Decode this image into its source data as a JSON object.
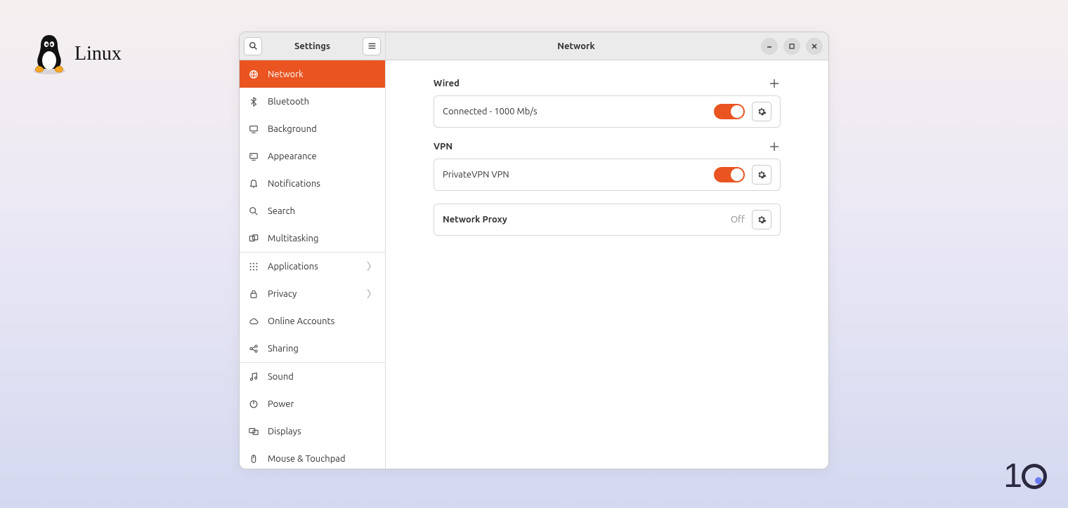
{
  "os_label": "Linux",
  "sidebar": {
    "title": "Settings",
    "items": [
      {
        "icon": "globe",
        "label": "Network",
        "active": true
      },
      {
        "icon": "bluetooth",
        "label": "Bluetooth"
      },
      {
        "icon": "desktop",
        "label": "Background"
      },
      {
        "icon": "appearance",
        "label": "Appearance"
      },
      {
        "icon": "bell",
        "label": "Notifications"
      },
      {
        "icon": "search",
        "label": "Search"
      },
      {
        "icon": "multitask",
        "label": "Multitasking",
        "sep_after": true
      },
      {
        "icon": "grid",
        "label": "Applications",
        "chev": true
      },
      {
        "icon": "lock",
        "label": "Privacy",
        "chev": true
      },
      {
        "icon": "cloud",
        "label": "Online Accounts"
      },
      {
        "icon": "share",
        "label": "Sharing",
        "sep_after": true
      },
      {
        "icon": "music",
        "label": "Sound"
      },
      {
        "icon": "power",
        "label": "Power"
      },
      {
        "icon": "displays",
        "label": "Displays"
      },
      {
        "icon": "mouse",
        "label": "Mouse & Touchpad"
      }
    ]
  },
  "panel": {
    "title": "Network",
    "sections": {
      "wired": {
        "header": "Wired",
        "rows": [
          {
            "label": "Connected - 1000 Mb/s",
            "toggle": true
          }
        ]
      },
      "vpn": {
        "header": "VPN",
        "rows": [
          {
            "label": "PrivateVPN VPN",
            "toggle": true
          }
        ]
      },
      "proxy": {
        "label": "Network Proxy",
        "status": "Off"
      }
    }
  },
  "colors": {
    "accent": "#e95420"
  }
}
